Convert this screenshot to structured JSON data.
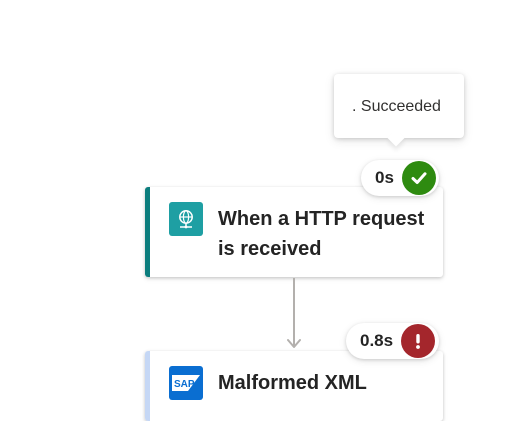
{
  "tooltip": {
    "text": ". Succeeded"
  },
  "trigger": {
    "title": "When a HTTP request is received",
    "icon": "http-request-globe-icon",
    "duration": "0s",
    "status": "succeeded",
    "status_icon": "checkmark-icon",
    "accent_color": "#0b7d7d",
    "icon_bg_color": "#1e9fa3",
    "status_color": "#2e8b10"
  },
  "action": {
    "title": "Malformed XML",
    "icon": "sap-logo-icon",
    "icon_text": "SAP",
    "duration": "0.8s",
    "status": "failed",
    "status_icon": "exclamation-icon",
    "accent_color": "#c5d7f5",
    "icon_bg_color": "#0a6ed1",
    "status_color": "#a4262c"
  },
  "connector": {
    "color": "#b3b0ad"
  }
}
